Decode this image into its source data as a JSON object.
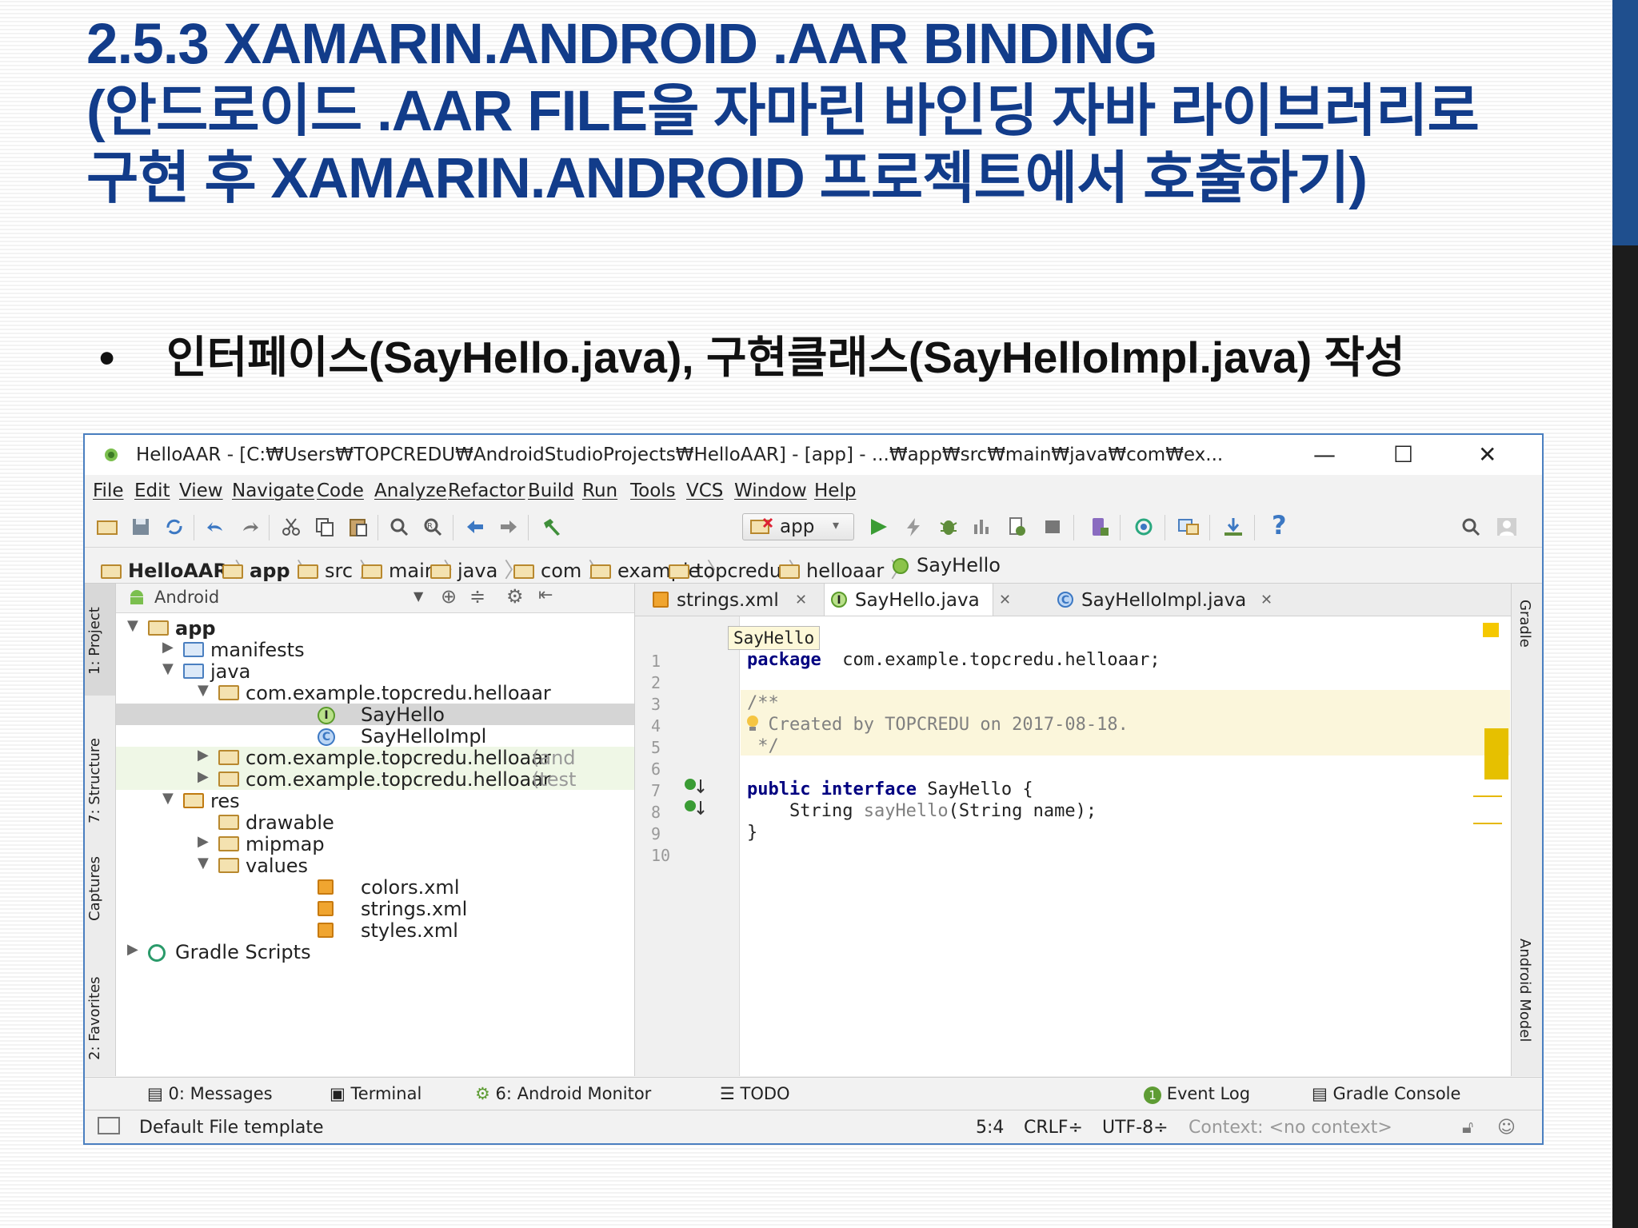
{
  "slide": {
    "title_line1": "2.5.3 XAMARIN.ANDROID .AAR BINDING",
    "title_line2": "(안드로이드 .AAR FILE을 자마린 바인딩 자바 라이브러리로",
    "title_line3": "구현 후 XAMARIN.ANDROID 프로젝트에서 호출하기)",
    "bullet": "인터페이스(SayHello.java), 구현클래스(SayHelloImpl.java) 작성",
    "bullet_mark": "•"
  },
  "window": {
    "title": "HelloAAR - [C:₩Users₩TOPCREDU₩AndroidStudioProjects₩HelloAAR] - [app] - ...₩app₩src₩main₩java₩com₩ex...",
    "minimize": "—",
    "maximize": "☐",
    "close": "✕"
  },
  "menu": [
    "File",
    "Edit",
    "View",
    "Navigate",
    "Code",
    "Analyze",
    "Refactor",
    "Build",
    "Run",
    "Tools",
    "VCS",
    "Window",
    "Help"
  ],
  "toolbar": {
    "run_config": "app",
    "help": "?"
  },
  "breadcrumbs": [
    "HelloAAR",
    "app",
    "src",
    "main",
    "java",
    "com",
    "example",
    "topcredu",
    "helloaar",
    "SayHello"
  ],
  "left_tabs": [
    "1: Project",
    "7: Structure",
    "Captures",
    "2: Favorites"
  ],
  "right_tabs": [
    "Gradle",
    "Android Model"
  ],
  "project": {
    "view": "Android",
    "tree": [
      {
        "label": "app",
        "indent": 0,
        "arrow": "▼",
        "icon": "folder",
        "bold": true
      },
      {
        "label": "manifests",
        "indent": 1,
        "arrow": "▶",
        "icon": "folder-blue"
      },
      {
        "label": "java",
        "indent": 1,
        "arrow": "▼",
        "icon": "folder-blue"
      },
      {
        "label": "com.example.topcredu.helloaar",
        "indent": 2,
        "arrow": "▼",
        "icon": "folder"
      },
      {
        "label": "SayHello",
        "indent": 3,
        "arrow": "",
        "icon": "interface",
        "selected": true
      },
      {
        "label": "SayHelloImpl",
        "indent": 3,
        "arrow": "",
        "icon": "class"
      },
      {
        "label": "com.example.topcredu.helloaar",
        "suffix": "(and",
        "indent": 2,
        "arrow": "▶",
        "icon": "folder",
        "tinted": true
      },
      {
        "label": "com.example.topcredu.helloaar",
        "suffix": "(test",
        "indent": 2,
        "arrow": "▶",
        "icon": "folder",
        "tinted": true
      },
      {
        "label": "res",
        "indent": 1,
        "arrow": "▼",
        "icon": "folder-res"
      },
      {
        "label": "drawable",
        "indent": 2,
        "arrow": "",
        "icon": "folder"
      },
      {
        "label": "mipmap",
        "indent": 2,
        "arrow": "▶",
        "icon": "folder"
      },
      {
        "label": "values",
        "indent": 2,
        "arrow": "▼",
        "icon": "folder"
      },
      {
        "label": "colors.xml",
        "indent": 3,
        "arrow": "",
        "icon": "xml"
      },
      {
        "label": "strings.xml",
        "indent": 3,
        "arrow": "",
        "icon": "xml"
      },
      {
        "label": "styles.xml",
        "indent": 3,
        "arrow": "",
        "icon": "xml"
      },
      {
        "label": "Gradle Scripts",
        "indent": 0,
        "arrow": "▶",
        "icon": "gradle"
      }
    ]
  },
  "tabs": [
    {
      "label": "strings.xml",
      "close": "✕",
      "active": false
    },
    {
      "label": "SayHello.java",
      "close": "✕",
      "active": true
    },
    {
      "label": "SayHelloImpl.java",
      "close": "✕",
      "active": false
    }
  ],
  "editor": {
    "breadcrumb_tip": "SayHello",
    "line_numbers": [
      "1",
      "2",
      "3",
      "4",
      "5",
      "6",
      "7",
      "8",
      "9",
      "10"
    ],
    "lines": [
      {
        "n": 1,
        "parts": [
          [
            "kw",
            "package"
          ],
          [
            "",
            "  com.example.topcredu.helloaar;"
          ]
        ]
      },
      {
        "n": 2,
        "parts": []
      },
      {
        "n": 3,
        "parts": [
          [
            "cm",
            "/**"
          ]
        ]
      },
      {
        "n": 4,
        "parts": [
          [
            "cm",
            "  Created by TOPCREDU on 2017-08-18."
          ]
        ]
      },
      {
        "n": 5,
        "parts": [
          [
            "cm",
            " */"
          ]
        ]
      },
      {
        "n": 6,
        "parts": []
      },
      {
        "n": 7,
        "parts": [
          [
            "kw",
            "public"
          ],
          [
            "",
            " "
          ],
          [
            "kw",
            "interface"
          ],
          [
            "",
            " SayHello {"
          ]
        ]
      },
      {
        "n": 8,
        "parts": [
          [
            "",
            "    String "
          ],
          [
            "cm",
            "sayHello"
          ],
          [
            "",
            "(String name);"
          ]
        ]
      },
      {
        "n": 9,
        "parts": [
          [
            "",
            "}"
          ]
        ]
      },
      {
        "n": 10,
        "parts": []
      }
    ]
  },
  "bottom_tools": [
    "0: Messages",
    "Terminal",
    "6: Android Monitor",
    "TODO",
    "Event Log",
    "Gradle Console"
  ],
  "event_count": "1",
  "status": {
    "message": "Default File template",
    "position": "5:4",
    "line_sep": "CRLF÷",
    "encoding": "UTF-8÷",
    "context": "Context: <no context>"
  },
  "colors": {
    "title": "#123c8a",
    "window_border": "#4a7fc0",
    "keyword": "#000080",
    "comment": "#808080"
  }
}
